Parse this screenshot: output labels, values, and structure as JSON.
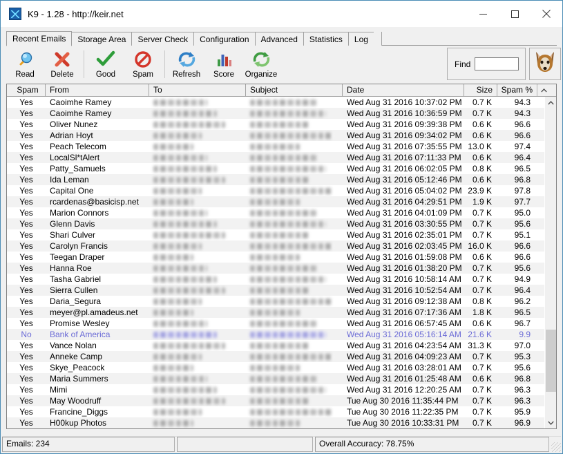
{
  "window": {
    "title": "K9 - 1.28 - http://keir.net",
    "icon": "k9-app-icon",
    "minimize_label": "–",
    "maximize_label": "□",
    "close_label": "✕"
  },
  "tabs": [
    {
      "label": "Recent Emails",
      "active": true
    },
    {
      "label": "Storage Area",
      "active": false
    },
    {
      "label": "Server Check",
      "active": false
    },
    {
      "label": "Configuration",
      "active": false
    },
    {
      "label": "Advanced",
      "active": false
    },
    {
      "label": "Statistics",
      "active": false
    },
    {
      "label": "Log",
      "active": false
    }
  ],
  "toolbar": {
    "buttons": [
      {
        "label": "Read",
        "icon": "magnifier-icon"
      },
      {
        "label": "Delete",
        "icon": "red-x-icon"
      },
      {
        "label": "Good",
        "icon": "green-check-icon"
      },
      {
        "label": "Spam",
        "icon": "red-no-entry-icon"
      },
      {
        "label": "Refresh",
        "icon": "blue-refresh-icon"
      },
      {
        "label": "Score",
        "icon": "bar-chart-icon"
      },
      {
        "label": "Organize",
        "icon": "green-refresh-icon"
      }
    ],
    "find_label": "Find",
    "find_value": "",
    "find_placeholder": "",
    "mascot_icon": "fox-head-icon"
  },
  "table": {
    "columns": [
      {
        "key": "spam",
        "label": "Spam"
      },
      {
        "key": "from",
        "label": "From"
      },
      {
        "key": "to",
        "label": "To"
      },
      {
        "key": "subject",
        "label": "Subject"
      },
      {
        "key": "date",
        "label": "Date"
      },
      {
        "key": "size",
        "label": "Size"
      },
      {
        "key": "pct",
        "label": "Spam %"
      }
    ],
    "rows": [
      {
        "spam": "Yes",
        "from": "Caoimhe Ramey",
        "to": "",
        "subject": "",
        "date": "Wed Aug 31 2016  10:37:02 PM",
        "size": "0.7 K",
        "pct": "94.3",
        "selected": false
      },
      {
        "spam": "Yes",
        "from": "Caoimhe Ramey",
        "to": "",
        "subject": "",
        "date": "Wed Aug 31 2016  10:36:59 PM",
        "size": "0.7 K",
        "pct": "94.3",
        "selected": false
      },
      {
        "spam": "Yes",
        "from": "Oliver Nunez",
        "to": "",
        "subject": "",
        "date": "Wed Aug 31 2016  09:39:38 PM",
        "size": "0.6 K",
        "pct": "96.6",
        "selected": false
      },
      {
        "spam": "Yes",
        "from": "Adrian Hoyt",
        "to": "",
        "subject": "",
        "date": "Wed Aug 31 2016  09:34:02 PM",
        "size": "0.6 K",
        "pct": "96.6",
        "selected": false
      },
      {
        "spam": "Yes",
        "from": "Peach Telecom",
        "to": "",
        "subject": "",
        "date": "Wed Aug 31 2016  07:35:55 PM",
        "size": "13.0 K",
        "pct": "97.4",
        "selected": false
      },
      {
        "spam": "Yes",
        "from": "LocalSl*tAlert",
        "to": "",
        "subject": "",
        "date": "Wed Aug 31 2016  07:11:33 PM",
        "size": "0.6 K",
        "pct": "96.4",
        "selected": false
      },
      {
        "spam": "Yes",
        "from": "Patty_Samuels",
        "to": "",
        "subject": "",
        "date": "Wed Aug 31 2016  06:02:05 PM",
        "size": "0.8 K",
        "pct": "96.5",
        "selected": false
      },
      {
        "spam": "Yes",
        "from": "Ida Leman",
        "to": "",
        "subject": "",
        "date": "Wed Aug 31 2016  05:12:46 PM",
        "size": "0.6 K",
        "pct": "96.8",
        "selected": false
      },
      {
        "spam": "Yes",
        "from": "Capital One",
        "to": "",
        "subject": "",
        "date": "Wed Aug 31 2016  05:04:02 PM",
        "size": "23.9 K",
        "pct": "97.8",
        "selected": false
      },
      {
        "spam": "Yes",
        "from": "rcardenas@basicisp.net",
        "to": "",
        "subject": "",
        "date": "Wed Aug 31 2016  04:29:51 PM",
        "size": "1.9 K",
        "pct": "97.7",
        "selected": false
      },
      {
        "spam": "Yes",
        "from": "Marion Connors",
        "to": "",
        "subject": "",
        "date": "Wed Aug 31 2016  04:01:09 PM",
        "size": "0.7 K",
        "pct": "95.0",
        "selected": false
      },
      {
        "spam": "Yes",
        "from": "Glenn Davis",
        "to": "",
        "subject": "",
        "date": "Wed Aug 31 2016  03:30:55 PM",
        "size": "0.7 K",
        "pct": "95.6",
        "selected": false
      },
      {
        "spam": "Yes",
        "from": "Shari Culver",
        "to": "",
        "subject": "",
        "date": "Wed Aug 31 2016  02:35:01 PM",
        "size": "0.7 K",
        "pct": "95.1",
        "selected": false
      },
      {
        "spam": "Yes",
        "from": "Carolyn Francis",
        "to": "",
        "subject": "",
        "date": "Wed Aug 31 2016  02:03:45 PM",
        "size": "16.0 K",
        "pct": "96.6",
        "selected": false
      },
      {
        "spam": "Yes",
        "from": "Teegan Draper",
        "to": "",
        "subject": "",
        "date": "Wed Aug 31 2016  01:59:08 PM",
        "size": "0.6 K",
        "pct": "96.6",
        "selected": false
      },
      {
        "spam": "Yes",
        "from": "Hanna Roe",
        "to": "",
        "subject": "",
        "date": "Wed Aug 31 2016  01:38:20 PM",
        "size": "0.7 K",
        "pct": "95.6",
        "selected": false
      },
      {
        "spam": "Yes",
        "from": "Tasha Gabriel",
        "to": "",
        "subject": "",
        "date": "Wed Aug 31 2016  10:58:14 AM",
        "size": "0.7 K",
        "pct": "94.9",
        "selected": false
      },
      {
        "spam": "Yes",
        "from": "Sierra Cullen",
        "to": "",
        "subject": "",
        "date": "Wed Aug 31 2016  10:52:54 AM",
        "size": "0.7 K",
        "pct": "96.4",
        "selected": false
      },
      {
        "spam": "Yes",
        "from": "Daria_Segura",
        "to": "",
        "subject": "",
        "date": "Wed Aug 31 2016  09:12:38 AM",
        "size": "0.8 K",
        "pct": "96.2",
        "selected": false
      },
      {
        "spam": "Yes",
        "from": "meyer@pl.amadeus.net",
        "to": "",
        "subject": "",
        "date": "Wed Aug 31 2016  07:17:36 AM",
        "size": "1.8 K",
        "pct": "96.5",
        "selected": false
      },
      {
        "spam": "Yes",
        "from": "Promise Wesley",
        "to": "",
        "subject": "",
        "date": "Wed Aug 31 2016  06:57:45 AM",
        "size": "0.6 K",
        "pct": "96.7",
        "selected": false
      },
      {
        "spam": "No",
        "from": "Bank of America",
        "to": "",
        "subject": "",
        "date": "Wed Aug 31 2016  05:16:14 AM",
        "size": "21.6 K",
        "pct": "9.9",
        "selected": true
      },
      {
        "spam": "Yes",
        "from": "Vance Nolan",
        "to": "",
        "subject": "",
        "date": "Wed Aug 31 2016  04:23:54 AM",
        "size": "31.3 K",
        "pct": "97.0",
        "selected": false
      },
      {
        "spam": "Yes",
        "from": "Anneke Camp",
        "to": "",
        "subject": "",
        "date": "Wed Aug 31 2016  04:09:23 AM",
        "size": "0.7 K",
        "pct": "95.3",
        "selected": false
      },
      {
        "spam": "Yes",
        "from": "Skye_Peacock",
        "to": "",
        "subject": "",
        "date": "Wed Aug 31 2016  03:28:01 AM",
        "size": "0.7 K",
        "pct": "95.6",
        "selected": false
      },
      {
        "spam": "Yes",
        "from": "Maria Summers",
        "to": "",
        "subject": "",
        "date": "Wed Aug 31 2016  01:25:48 AM",
        "size": "0.6 K",
        "pct": "96.8",
        "selected": false
      },
      {
        "spam": "Yes",
        "from": "Mimi",
        "to": "",
        "subject": "",
        "date": "Wed Aug 31 2016  12:20:25 AM",
        "size": "0.7 K",
        "pct": "96.3",
        "selected": false
      },
      {
        "spam": "Yes",
        "from": "May Woodruff",
        "to": "",
        "subject": "",
        "date": "Tue Aug 30 2016  11:35:44 PM",
        "size": "0.7 K",
        "pct": "96.3",
        "selected": false
      },
      {
        "spam": "Yes",
        "from": "Francine_Diggs",
        "to": "",
        "subject": "",
        "date": "Tue Aug 30 2016  11:22:35 PM",
        "size": "0.7 K",
        "pct": "95.9",
        "selected": false
      },
      {
        "spam": "Yes",
        "from": "H00kup Photos",
        "to": "",
        "subject": "",
        "date": "Tue Aug 30 2016  10:33:31 PM",
        "size": "0.7 K",
        "pct": "96.9",
        "selected": false
      }
    ]
  },
  "statusbar": {
    "emails": "Emails: 234",
    "middle": "",
    "accuracy": "Overall Accuracy: 78.75%"
  },
  "colors": {
    "selected_row_text": "#6b6bd6",
    "window_border": "#4a8cb5",
    "chrome": "#f0f0f0"
  }
}
